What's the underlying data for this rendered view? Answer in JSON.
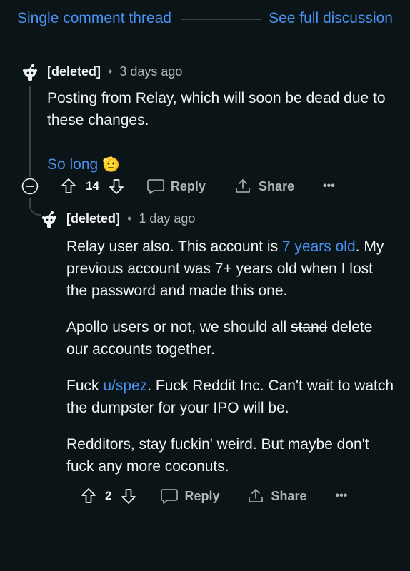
{
  "header": {
    "title": "Single comment thread",
    "see_full": "See full discussion"
  },
  "comment1": {
    "user": "[deleted]",
    "time": "3 days ago",
    "text": "Posting from Relay, which will soon be dead due to these changes.",
    "link_text": "So long",
    "emoji": "🫡",
    "votes": "14",
    "reply": "Reply",
    "share": "Share"
  },
  "comment2": {
    "user": "[deleted]",
    "time": "1 day ago",
    "p1_before": "Relay user also. This account is ",
    "p1_link": "7 years old",
    "p1_after": ". My previous account was 7+ years old when I lost the password and made this one.",
    "p2_before": "Apollo users or not, we should all ",
    "p2_strike": "stand",
    "p2_after": " delete our accounts together.",
    "p3_before": "Fuck ",
    "p3_link": "u/spez",
    "p3_after": ". Fuck Reddit Inc. Can't wait to watch the dumpster for your IPO will be.",
    "p4": "Redditors, stay fuckin' weird. But maybe don't fuck any more coconuts.",
    "votes": "2",
    "reply": "Reply",
    "share": "Share"
  }
}
